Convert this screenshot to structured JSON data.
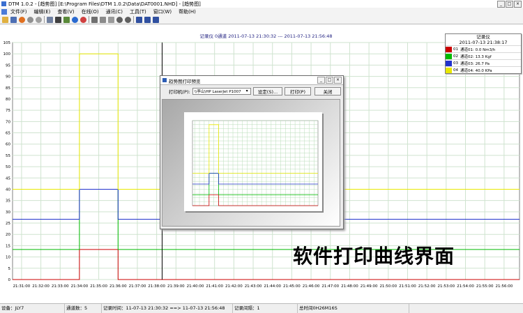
{
  "window": {
    "title": "DTM 1.0.2 - [趋势图] [E:\\Program Files\\DTM 1.0.2\\Data\\DAT0001.NHD] - [趋势图]",
    "buttons": [
      "_",
      "□",
      "×"
    ]
  },
  "menu": [
    "文件(F)",
    "编辑(E)",
    "查看(V)",
    "在线(O)",
    "通讯(C)",
    "工具(T)",
    "窗口(W)",
    "帮助(H)"
  ],
  "toolbar": {
    "icons": [
      "open-icon",
      "save-icon",
      "record-icon",
      "stop-icon",
      "pause-icon",
      "table-icon",
      "sum-icon",
      "chart-icon",
      "info-icon",
      "palette-icon",
      "print-icon",
      "print-preview-icon",
      "copy-icon",
      "zoom-in-icon",
      "zoom-out-icon",
      "window-cascade-icon",
      "window-tile-h-icon",
      "window-tile-v-icon"
    ]
  },
  "chart_data": {
    "type": "line",
    "title": "记录仪 0通道 2011-07-13 21:30:32 --- 2011-07-13 21:56:48",
    "ylim": [
      0,
      100
    ],
    "yticks": [
      0,
      5,
      10,
      15,
      20,
      25,
      30,
      35,
      40,
      45,
      50,
      55,
      60,
      65,
      70,
      75,
      80,
      85,
      90,
      95,
      100,
      105
    ],
    "xticks": [
      "21:31:00",
      "21:32:00",
      "21:33:00",
      "21:34:00",
      "21:35:00",
      "21:36:00",
      "21:37:00",
      "21:38:00",
      "21:39:00",
      "21:40:00",
      "21:41:00",
      "21:42:00",
      "21:43:00",
      "21:44:00",
      "21:45:00",
      "21:46:00",
      "21:47:00",
      "21:48:00",
      "21:49:00",
      "21:50:00",
      "21:51:00",
      "21:52:00",
      "21:53:00",
      "21:54:00",
      "21:55:00",
      "21:56:00"
    ],
    "xrange": [
      "21:30:32",
      "21:56:48"
    ],
    "grid": true,
    "series": [
      {
        "name": "通道01",
        "color": "#cc0000",
        "points": [
          [
            "21:30:32",
            0
          ],
          [
            "21:34:00",
            0
          ],
          [
            "21:34:00",
            13.3
          ],
          [
            "21:36:00",
            13.3
          ],
          [
            "21:36:00",
            0
          ],
          [
            "21:56:48",
            0
          ]
        ]
      },
      {
        "name": "通道02",
        "color": "#00bb00",
        "points": [
          [
            "21:30:32",
            13.3
          ],
          [
            "21:34:00",
            13.3
          ],
          [
            "21:34:00",
            40
          ],
          [
            "21:36:00",
            40
          ],
          [
            "21:36:00",
            13.3
          ],
          [
            "21:56:48",
            13.3
          ]
        ]
      },
      {
        "name": "通道03",
        "color": "#2233cc",
        "points": [
          [
            "21:30:32",
            26.7
          ],
          [
            "21:34:00",
            26.7
          ],
          [
            "21:34:00",
            40
          ],
          [
            "21:36:00",
            40
          ],
          [
            "21:36:00",
            26.7
          ],
          [
            "21:56:48",
            26.7
          ]
        ]
      },
      {
        "name": "通道04",
        "color": "#e8e800",
        "points": [
          [
            "21:30:32",
            40
          ],
          [
            "21:34:00",
            40
          ],
          [
            "21:34:00",
            100
          ],
          [
            "21:36:00",
            100
          ],
          [
            "21:36:00",
            40
          ],
          [
            "21:56:48",
            40
          ]
        ]
      }
    ],
    "cursor_x": "21:38:17"
  },
  "legend": {
    "title": "记录仪",
    "time": "2011-07-13 21:38:17",
    "items": [
      {
        "id": "01",
        "label": "通道01: 0.0 Nm3/h",
        "color": "#cc0000"
      },
      {
        "id": "02",
        "label": "通道02: 13.3 Kgf",
        "color": "#00bb00"
      },
      {
        "id": "03",
        "label": "通道03: 26.7 Pa",
        "color": "#2233cc"
      },
      {
        "id": "04",
        "label": "通道04: 40.0 KPa",
        "color": "#e8e800"
      }
    ]
  },
  "dialog": {
    "title": "趋势图打印预览",
    "printer_label": "打印机(P):",
    "printer_value": "\\\\李山\\HP LaserJet P1007",
    "setup_button": "设定(S)...",
    "print_button": "打印(P)",
    "close_button": "关闭"
  },
  "overlay_text": "软件打印曲线界面",
  "status": [
    "设备：JLY7",
    "通道数：5",
    "记录时间：11-07-13 21:30:32 ==> 11-07-13 21:56:48",
    "记录间隔：1",
    "总时间0H26M16S"
  ]
}
